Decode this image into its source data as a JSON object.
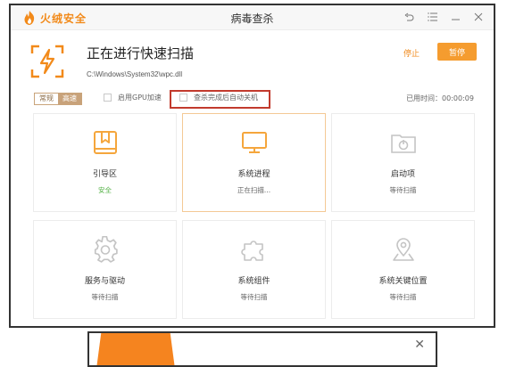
{
  "app": {
    "brand_name": "火绒安全",
    "window_title": "病毒查杀",
    "brand_color": "#f28a1a"
  },
  "scan": {
    "title": "正在进行快速扫描",
    "current_file": "C:\\Windows\\System32\\wpc.dll",
    "stop_label": "停止",
    "pause_label": "暂停",
    "accent_color": "#f59c2f"
  },
  "options": {
    "modes": [
      "常规",
      "高速"
    ],
    "active_mode": "高速",
    "gpu_label": "启用GPU加速",
    "shutdown_label": "查杀完成后自动关机",
    "elapsed_label": "已用时间：00:00:09"
  },
  "items": [
    {
      "title": "引导区",
      "status": "安全",
      "icon": "bookmark-icon"
    },
    {
      "title": "系统进程",
      "status": "正在扫描...",
      "icon": "monitor-icon"
    },
    {
      "title": "启动项",
      "status": "等待扫描",
      "icon": "power-folder-icon"
    },
    {
      "title": "服务与驱动",
      "status": "等待扫描",
      "icon": "gear-icon"
    },
    {
      "title": "系统组件",
      "status": "等待扫描",
      "icon": "puzzle-icon"
    },
    {
      "title": "系统关键位置",
      "status": "等待扫描",
      "icon": "location-pin-icon"
    }
  ],
  "colors": {
    "status_safe": "#52b043",
    "highlight_box": "#c23a2d"
  }
}
